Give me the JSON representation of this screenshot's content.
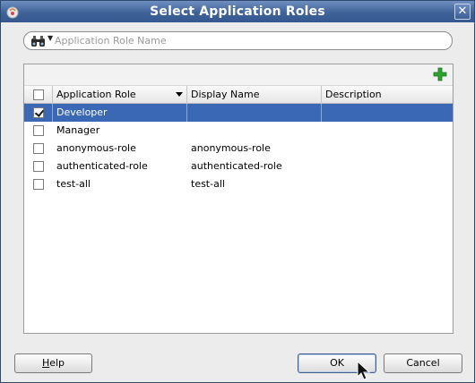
{
  "window": {
    "title": "Select Application Roles"
  },
  "search": {
    "placeholder": "Application Role Name",
    "value": ""
  },
  "toolbar": {
    "add_icon": "add-icon"
  },
  "table": {
    "columns": [
      "Application Role",
      "Display Name",
      "Description"
    ],
    "rows": [
      {
        "checked": true,
        "role": "Developer",
        "display": "",
        "description": "",
        "selected": true
      },
      {
        "checked": false,
        "role": "Manager",
        "display": "",
        "description": "",
        "selected": false
      },
      {
        "checked": false,
        "role": "anonymous-role",
        "display": "anonymous-role",
        "description": "",
        "selected": false
      },
      {
        "checked": false,
        "role": "authenticated-role",
        "display": "authenticated-role",
        "description": "",
        "selected": false
      },
      {
        "checked": false,
        "role": "test-all",
        "display": "test-all",
        "description": "",
        "selected": false
      }
    ]
  },
  "buttons": {
    "help_first": "H",
    "help_rest": "elp",
    "ok": "OK",
    "cancel": "Cancel"
  },
  "colors": {
    "selection": "#3a68b5",
    "titlebar": "#3f6298"
  }
}
